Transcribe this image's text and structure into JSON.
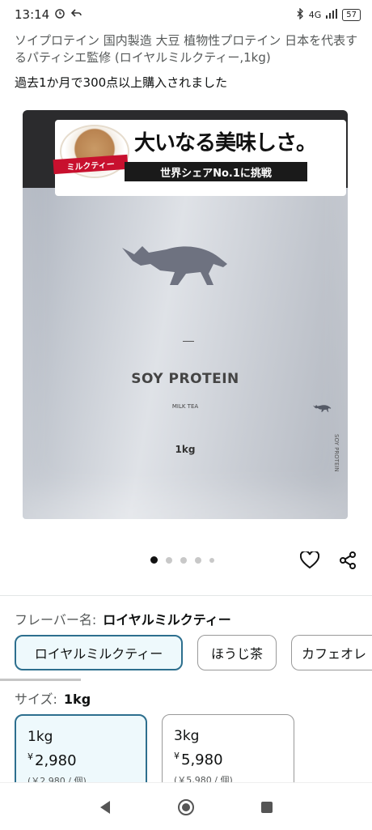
{
  "status_bar": {
    "time": "13:14",
    "network": "4G",
    "battery": "57"
  },
  "product": {
    "title": "ソイプロテイン 国内製造 大豆 植物性プロテイン 日本を代表するパティシエ監修 (ロイヤルミルクティー,1kg)",
    "purchase_note": "過去1か月で300点以上購入されました"
  },
  "image": {
    "catch_copy": "大いなる美味しさ。",
    "ribbon": "ミルクティー",
    "subcatch": "世界シェアNo.1に挑戦",
    "pack_name": "SOY PROTEIN",
    "pack_flavor": "MILK TEA",
    "pack_weight": "1kg",
    "side_text": "SOY PROTEIN",
    "dots_total": 5,
    "active_dot": 1
  },
  "flavor": {
    "label": "フレーバー名:",
    "selected": "ロイヤルミルクティー",
    "options": [
      "ロイヤルミルクティー",
      "ほうじ茶",
      "カフェオレ"
    ]
  },
  "size": {
    "label": "サイズ:",
    "selected": "1kg",
    "options": [
      {
        "name": "1kg",
        "currency": "¥",
        "price": "2,980",
        "unit": "(￥2,980 / 個)"
      },
      {
        "name": "3kg",
        "currency": "¥",
        "price": "5,980",
        "unit": "(￥5,980 / 個)"
      }
    ]
  },
  "icons": [
    "alarm-icon",
    "back-arrow-icon",
    "bluetooth-icon",
    "signal-icon",
    "battery-icon",
    "heart-icon",
    "share-icon",
    "nav-back-icon",
    "nav-home-icon",
    "nav-recents-icon"
  ]
}
